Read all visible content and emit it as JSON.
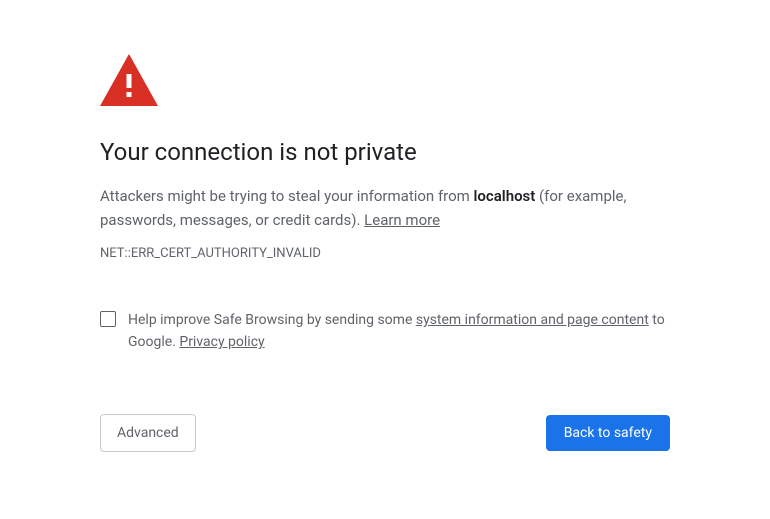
{
  "heading": "Your connection is not private",
  "description": {
    "prefix": "Attackers might be trying to steal your information from ",
    "hostname": "localhost",
    "suffix": " (for example, passwords, messages, or credit cards). ",
    "learn_more": "Learn more"
  },
  "error_code": "NET::ERR_CERT_AUTHORITY_INVALID",
  "opt_in": {
    "prefix": "Help improve Safe Browsing by sending some ",
    "link1": "system information and page content",
    "mid": " to Google. ",
    "link2": "Privacy policy"
  },
  "buttons": {
    "advanced": "Advanced",
    "back_to_safety": "Back to safety"
  },
  "colors": {
    "danger": "#d93025",
    "primary": "#1a73e8"
  }
}
